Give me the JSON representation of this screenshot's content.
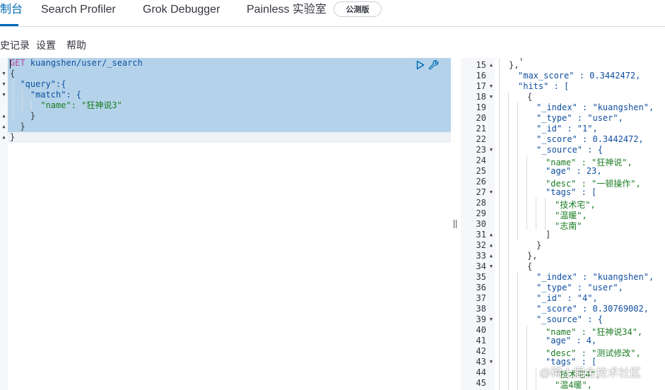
{
  "tabs": {
    "console": "制台",
    "search_profiler": "Search Profiler",
    "grok_debugger": "Grok Debugger",
    "painless": "Painless 实验室",
    "badge": "公测版"
  },
  "menu": {
    "history": "史记录",
    "settings": "设置",
    "help": "帮助"
  },
  "request": {
    "method": "GET",
    "path": "kuangshen/user/_search",
    "lines": [
      "{",
      "  \"query\":{",
      "    \"match\": {",
      "      \"name\": \"狂神说3\"",
      "    }",
      "  }",
      "}"
    ]
  },
  "response": {
    "line_numbers": [
      "15",
      "16",
      "17",
      "18",
      "19",
      "20",
      "21",
      "22",
      "23",
      "24",
      "25",
      "26",
      "27",
      "28",
      "29",
      "30",
      "31",
      "32",
      "33",
      "34",
      "35",
      "36",
      "37",
      "38",
      "39",
      "40",
      "41",
      "42",
      "43",
      "44",
      "45"
    ],
    "lines": [
      "},",
      "\"max_score\" : 0.3442472,",
      "\"hits\" : [",
      "{",
      "\"_index\" : \"kuangshen\",",
      "\"_type\" : \"user\",",
      "\"_id\" : \"1\",",
      "\"_score\" : 0.3442472,",
      "\"_source\" : {",
      "\"name\" : \"狂神说\",",
      "\"age\" : 23,",
      "\"desc\" : \"一顿操作\",",
      "\"tags\" : [",
      "\"技术宅\",",
      "\"温暖\",",
      "\"志南\"",
      "]",
      "}",
      "},",
      "{",
      "\"_index\" : \"kuangshen\",",
      "\"_type\" : \"user\",",
      "\"_id\" : \"4\",",
      "\"_score\" : 0.30769002,",
      "\"_source\" : {",
      "\"name\" : \"狂神说34\",",
      "\"age\" : 4,",
      "\"desc\" : \"测试修改\",",
      "\"tags\" : [",
      "\"技术宅4\",",
      "\"温4暖\","
    ]
  },
  "watermark": "@稀土掘金技术社区",
  "colors": {
    "accent": "#006bb4",
    "selection": "#b4d3ea",
    "string": "#1b7c23",
    "key": "#0f4fa0",
    "method": "#b1459b"
  }
}
